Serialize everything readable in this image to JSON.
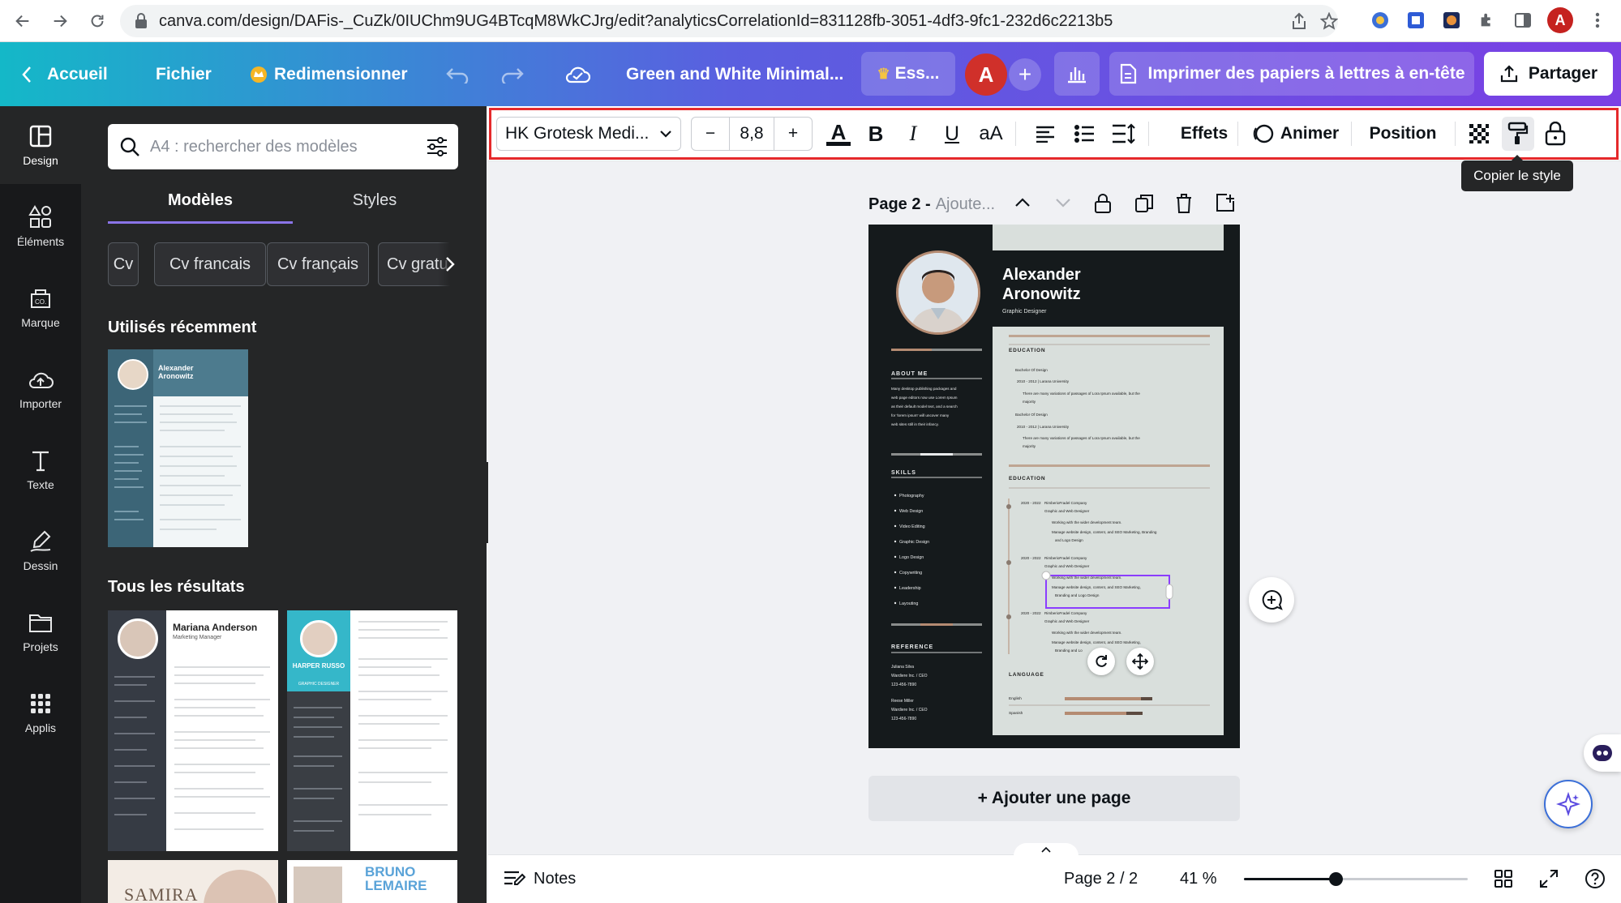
{
  "browser": {
    "url": "canva.com/design/DAFis-_CuZk/0IUChm9UG4BTcqM8WkCJrg/edit?analyticsCorrelationId=831128fb-3051-4df3-9fc1-232d6c2213b5",
    "profile_initial": "A"
  },
  "header": {
    "home": "Accueil",
    "file": "Fichier",
    "resize": "Redimensionner",
    "doc_title": "Green and White Minimal...",
    "trial": "Ess...",
    "avatar_initial": "A",
    "print": "Imprimer des papiers à lettres à en-tête",
    "share": "Partager"
  },
  "rail": [
    {
      "label": "Design",
      "icon": "layout-icon"
    },
    {
      "label": "Éléments",
      "icon": "shapes-icon"
    },
    {
      "label": "Marque",
      "icon": "brand-icon"
    },
    {
      "label": "Importer",
      "icon": "upload-icon"
    },
    {
      "label": "Texte",
      "icon": "text-icon"
    },
    {
      "label": "Dessin",
      "icon": "draw-icon"
    },
    {
      "label": "Projets",
      "icon": "folder-icon"
    },
    {
      "label": "Applis",
      "icon": "apps-icon"
    }
  ],
  "panel": {
    "search_placeholder": "A4 : rechercher des modèles",
    "tab_templates": "Modèles",
    "tab_styles": "Styles",
    "chips": [
      "Cv",
      "Cv francais",
      "Cv français",
      "Cv gratu"
    ],
    "recent_title": "Utilisés récemment",
    "results_title": "Tous les résultats",
    "recent_thumb": {
      "name1": "Alexander",
      "name2": "Aronowitz"
    },
    "results": [
      {
        "name": "Mariana Anderson",
        "role": "Marketing Manager"
      },
      {
        "name": "HARPER RUSSO",
        "role": "GRAPHIC DESIGNER"
      },
      {
        "name": "SAMIRA",
        "role": ""
      },
      {
        "name": "BRUNO LEMAIRE",
        "role": ""
      }
    ]
  },
  "toolbar": {
    "font": "HK Grotesk Medi...",
    "font_size": "8,8",
    "minus": "−",
    "plus": "+",
    "bold": "B",
    "italic": "I",
    "underline": "U",
    "case": "aA",
    "effects": "Effets",
    "animate": "Animer",
    "position": "Position",
    "tooltip": "Copier le style"
  },
  "page": {
    "label": "Page 2 -",
    "subtitle": "Ajoute...",
    "add_page": "+ Ajouter une page"
  },
  "resume": {
    "first_name": "Alexander",
    "last_name": "Aronowitz",
    "role": "Graphic Designer",
    "about_title": "ABOUT ME",
    "about_text": [
      "Many desktop publishing packages and",
      "web page editors now use Lorem Ipsum",
      "as their default model text, and a search",
      "for 'lorem ipsum' will uncover many",
      "web sites still in their infancy."
    ],
    "skills_title": "SKILLS",
    "skills": [
      "Photography",
      "Web Design",
      "Video Editing",
      "Graphic Design",
      "Logo Design",
      "Copywriting",
      "Leadership",
      "Layouting"
    ],
    "reference_title": "REFERENCE",
    "references": [
      {
        "name": "Juliana Silva",
        "company": "Wardiere Inc. / CEO",
        "phone": "123-456-7890"
      },
      {
        "name": "Reese Miller",
        "company": "Wardiere Inc. / CEO",
        "phone": "123-456-7890"
      }
    ],
    "education_title": "EDUCATION",
    "education": [
      {
        "degree": "Bachelor Of Design",
        "years": "2010 - 2012 | Larana University",
        "bullet": "There are many variations of passages of Lora Ipsum available, but the",
        "bullet2": "majority"
      },
      {
        "degree": "Bachelor Of Design",
        "years": "2010 - 2012 | Larana University",
        "bullet": "There are many variations of passages of Lora Ipsum available, but the",
        "bullet2": "majority"
      }
    ],
    "experience_title": "EDUCATION",
    "experience": [
      {
        "years": "2020 - 2022",
        "company": "RimberioFradel Company",
        "role": "Graphic and Web Designer",
        "b1": "Working with the wider development team.",
        "b2": "Manage website design, content, and SEO Marketing, Branding",
        "b3": "and Logo Design"
      },
      {
        "years": "2020 - 2022",
        "company": "RimberioFradel Company",
        "role": "Graphic and Web Designer",
        "b1": "Working with the wider development team.",
        "b2": "Manage website design, content, and SEO Marketing,",
        "b3": "Branding and Logo Design"
      },
      {
        "years": "2020 - 2022",
        "company": "RimberioFradel Company",
        "role": "Graphic and Web Designer",
        "b1": "Working with the wider development team.",
        "b2": "Manage website design, content, and SEO Marketing,",
        "b3": "Branding and Lo"
      }
    ],
    "language_title": "LANGUAGE",
    "languages": [
      "English",
      "Spanish"
    ]
  },
  "footer": {
    "notes": "Notes",
    "page_counter": "Page 2 / 2",
    "zoom": "41 %",
    "zoom_level": 0.41
  },
  "colors": {
    "accent": "#7d2ae8",
    "selection": "#8b3dff",
    "highlight_outline": "#e5292b",
    "resume_dark": "#151a1c",
    "resume_light": "#d9dfdc",
    "resume_bronze": "#b48b72"
  }
}
